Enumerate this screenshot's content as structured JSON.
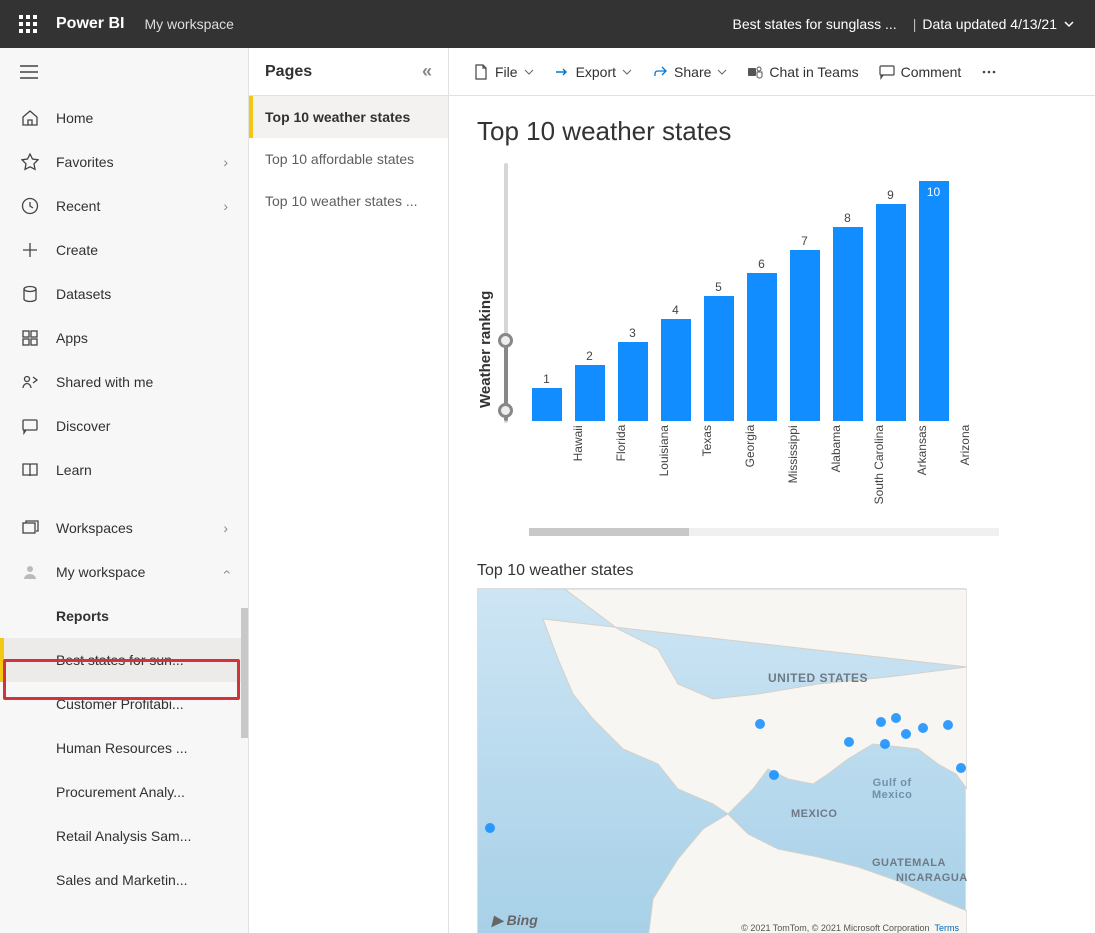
{
  "header": {
    "app_name": "Power BI",
    "workspace_label": "My workspace",
    "breadcrumb": "Best states for sunglass ...",
    "data_updated_label": "Data updated 4/13/21"
  },
  "nav": {
    "items": [
      {
        "icon": "home",
        "label": "Home"
      },
      {
        "icon": "star",
        "label": "Favorites",
        "chev": true
      },
      {
        "icon": "clock",
        "label": "Recent",
        "chev": true
      },
      {
        "icon": "plus",
        "label": "Create"
      },
      {
        "icon": "cylinder",
        "label": "Datasets"
      },
      {
        "icon": "grid",
        "label": "Apps"
      },
      {
        "icon": "person-share",
        "label": "Shared with me"
      },
      {
        "icon": "chat",
        "label": "Discover"
      },
      {
        "icon": "book",
        "label": "Learn"
      }
    ],
    "workspaces_label": "Workspaces",
    "my_workspace_label": "My workspace",
    "reports_header": "Reports",
    "reports": [
      "Best states for sun...",
      "Customer Profitabi...",
      "Human Resources ...",
      "Procurement Analy...",
      "Retail Analysis Sam...",
      "Sales and Marketin..."
    ]
  },
  "pages": {
    "title": "Pages",
    "items": [
      "Top 10 weather states",
      "Top 10 affordable states",
      "Top 10 weather states ..."
    ]
  },
  "toolbar": {
    "file": "File",
    "export": "Export",
    "share": "Share",
    "chat": "Chat in Teams",
    "comment": "Comment"
  },
  "report": {
    "title": "Top 10 weather states",
    "y_axis_label": "Weather ranking",
    "map_title": "Top 10 weather states",
    "map_country": "UNITED STATES",
    "map_mexico": "MEXICO",
    "map_gulf": "Gulf of\nMexico",
    "map_guatemala": "GUATEMALA",
    "map_nicaragua": "NICARAGUA",
    "bing_label": "Bing",
    "map_attribution": "© 2021 TomTom, © 2021 Microsoft Corporation",
    "map_terms": "Terms"
  },
  "chart_data": {
    "type": "bar",
    "title": "Top 10 weather states",
    "ylabel": "Weather ranking",
    "xlabel": "",
    "ylim": [
      0,
      10
    ],
    "categories": [
      "Hawaii",
      "Florida",
      "Louisiana",
      "Texas",
      "Georgia",
      "Mississippi",
      "Alabama",
      "South Carolina",
      "Arkansas",
      "Arizona"
    ],
    "values": [
      1,
      2,
      3,
      4,
      5,
      6,
      7,
      8,
      9,
      10
    ]
  },
  "map_points": [
    {
      "x": 7,
      "y": 234
    },
    {
      "x": 277,
      "y": 130
    },
    {
      "x": 291,
      "y": 181
    },
    {
      "x": 366,
      "y": 148
    },
    {
      "x": 398,
      "y": 128
    },
    {
      "x": 413,
      "y": 124
    },
    {
      "x": 402,
      "y": 150
    },
    {
      "x": 423,
      "y": 140
    },
    {
      "x": 440,
      "y": 134
    },
    {
      "x": 465,
      "y": 131
    },
    {
      "x": 478,
      "y": 174
    }
  ]
}
